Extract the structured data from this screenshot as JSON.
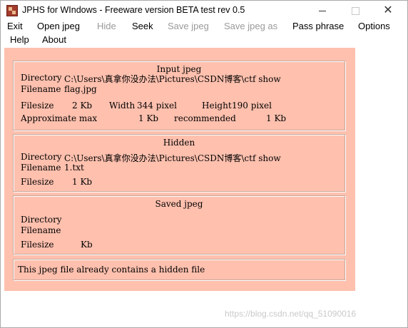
{
  "window": {
    "title": "JPHS for WIndows - Freeware version BETA test rev 0.5",
    "icon": "jphs-app-icon"
  },
  "menu": {
    "exit": "Exit",
    "open_jpeg": "Open jpeg",
    "hide": "Hide",
    "seek": "Seek",
    "save_jpeg": "Save jpeg",
    "save_jpeg_as": "Save jpeg as",
    "pass_phrase": "Pass phrase",
    "options": "Options",
    "help": "Help",
    "about": "About"
  },
  "input_jpeg": {
    "title": "Input jpeg",
    "directory_label": "Directory",
    "directory_value": "C:\\Users\\真拿你没办法\\Pictures\\CSDN博客\\ctf show",
    "filename_label": "Filename",
    "filename_value": "flag.jpg",
    "filesize_label": "Filesize",
    "filesize_value": "2 Kb",
    "width_label": "Width",
    "width_value": "344 pixel",
    "height_label": "Height",
    "height_value": "190 pixel",
    "approx_max_label": "Approximate max",
    "approx_max_value": "1 Kb",
    "recommended_label": "recommended",
    "recommended_value": "1 Kb"
  },
  "hidden": {
    "title": "Hidden",
    "directory_label": "Directory",
    "directory_value": "C:\\Users\\真拿你没办法\\Pictures\\CSDN博客\\ctf show",
    "filename_label": "Filename",
    "filename_value": "1.txt",
    "filesize_label": "Filesize",
    "filesize_value": "1 Kb"
  },
  "saved_jpeg": {
    "title": "Saved jpeg",
    "directory_label": "Directory",
    "filename_label": "Filename",
    "filesize_label": "Filesize",
    "filesize_unit": "Kb"
  },
  "status": {
    "message": "This jpeg file already contains a hidden file"
  },
  "watermark": "https://blog.csdn.net/qq_51090016"
}
